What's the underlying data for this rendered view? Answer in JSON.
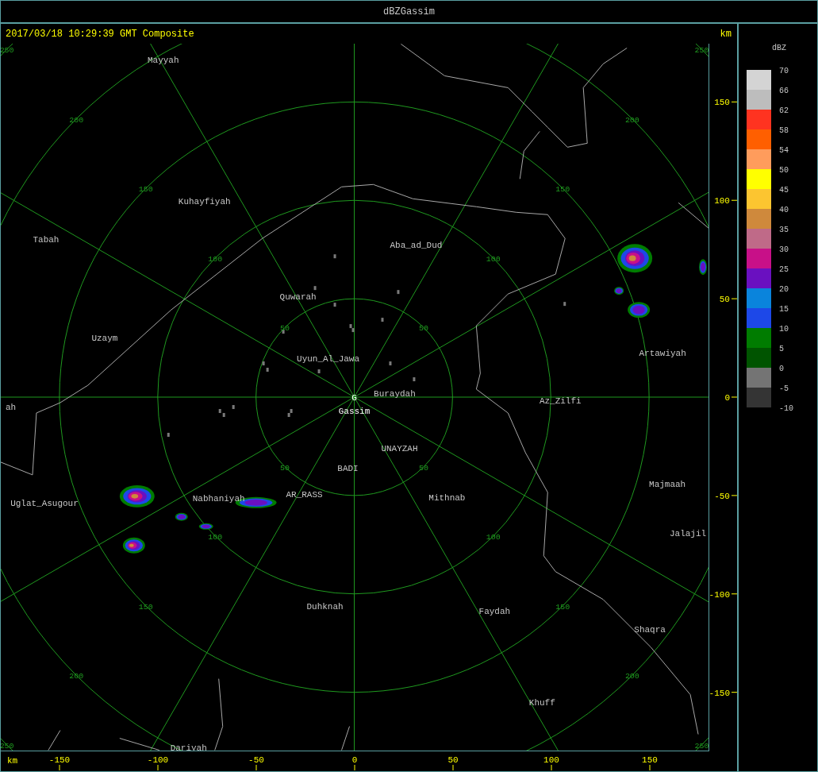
{
  "window": {
    "title": "dBZGassim"
  },
  "header": {
    "timestamp": "2017/03/18 10:29:39 GMT Composite",
    "unit": "km"
  },
  "radar": {
    "site_marker": "G",
    "site_name": "Gassim",
    "ring_labels": [
      "250",
      "200",
      "150",
      "100",
      "50",
      "250",
      "200",
      "150",
      "100",
      "50",
      "250",
      "200",
      "150",
      "100",
      "50",
      "250",
      "200",
      "150",
      "100",
      "50"
    ],
    "places": [
      "Mayyah",
      "Kuhayfiyah",
      "Tabah",
      "Aba_ad_Dud",
      "Quwarah",
      "Uzaym",
      "Artawiyah",
      "Uyun_Al_Jawa",
      "Buraydah",
      "Az_Zilfi",
      "ah",
      "UNAYZAH",
      "BADI",
      "Majmaah",
      "Uglat_Asugour",
      "Nabhaniyah",
      "AR_RASS",
      "Mithnab",
      "Jalajil",
      "Duhknah",
      "Faydah",
      "Shaqra",
      "Khuff",
      "Dariyah"
    ]
  },
  "x_axis": {
    "unit": "km",
    "ticks": [
      "-150",
      "-100",
      "-50",
      "0",
      "50",
      "100",
      "150"
    ]
  },
  "y_axis": {
    "ticks": [
      "150",
      "100",
      "50",
      "0",
      "-50",
      "-100",
      "-150"
    ]
  },
  "legend": {
    "title": "dBZ",
    "ticks": [
      "70",
      "66",
      "62",
      "58",
      "54",
      "50",
      "45",
      "40",
      "35",
      "30",
      "25",
      "20",
      "15",
      "10",
      "5",
      "0",
      "-5",
      "-10"
    ],
    "bins": [
      {
        "color": "#d4d4d4"
      },
      {
        "color": "#bdbdbd"
      },
      {
        "color": "#ff3320"
      },
      {
        "color": "#ff5f00"
      },
      {
        "color": "#ff9c5c"
      },
      {
        "color": "#ffff00"
      },
      {
        "color": "#fcc530"
      },
      {
        "color": "#cf893c"
      },
      {
        "color": "#bf6a88"
      },
      {
        "color": "#c81088"
      },
      {
        "color": "#6a10c0"
      },
      {
        "color": "#0a84dc"
      },
      {
        "color": "#1d48e8"
      },
      {
        "color": "#007c00"
      },
      {
        "color": "#005400"
      },
      {
        "color": "#747474"
      },
      {
        "color": "#343434"
      }
    ]
  }
}
